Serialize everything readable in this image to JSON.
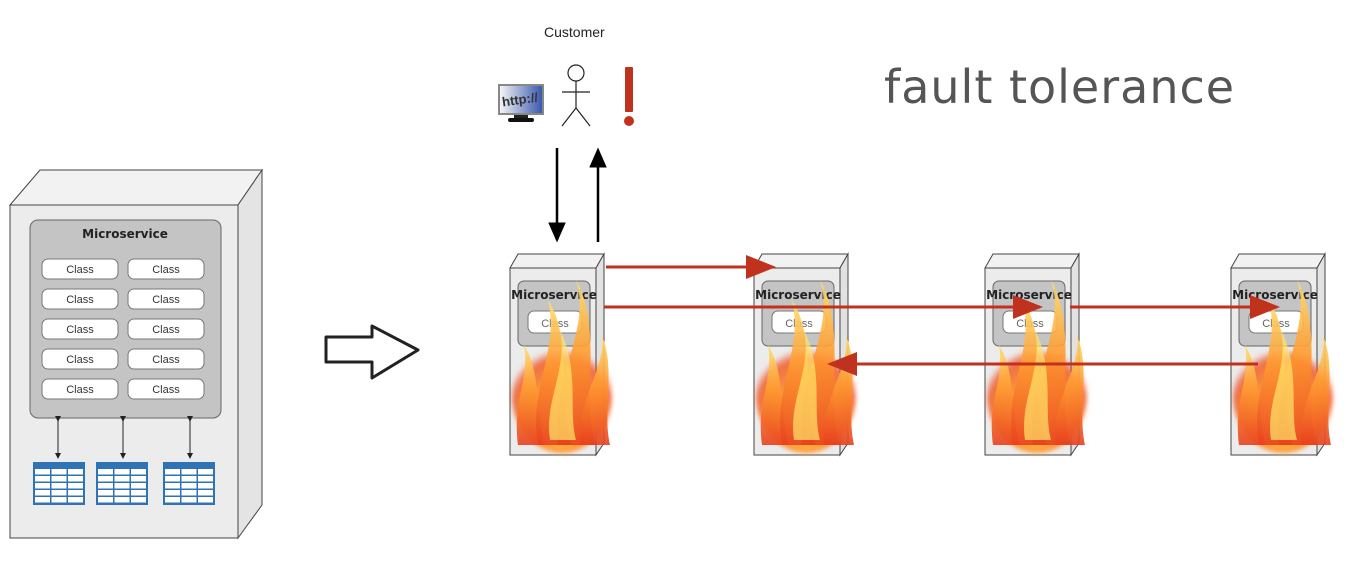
{
  "title": "fault tolerance",
  "customer": {
    "label": "Customer",
    "browser_icon_text": "http://",
    "alert_symbol": "!"
  },
  "monolith": {
    "service_label": "Microservice",
    "classes": [
      "Class",
      "Class",
      "Class",
      "Class",
      "Class",
      "Class",
      "Class",
      "Class",
      "Class",
      "Class"
    ],
    "database_count": 3
  },
  "transition_arrow": "hollow-right-arrow",
  "services": [
    {
      "label": "Microservice",
      "class_label": "Class",
      "state": "on-fire"
    },
    {
      "label": "Microservice",
      "class_label": "Class",
      "state": "on-fire"
    },
    {
      "label": "Microservice",
      "class_label": "Class",
      "state": "on-fire"
    },
    {
      "label": "Microservice",
      "class_label": "Class",
      "state": "on-fire"
    }
  ],
  "colors": {
    "call_arrow": "#c0321e",
    "alert": "#c0321e",
    "server_body": "#ececec",
    "service_box": "#c4c4c4",
    "db_blue": "#2f73b5",
    "title_text": "#555555"
  }
}
